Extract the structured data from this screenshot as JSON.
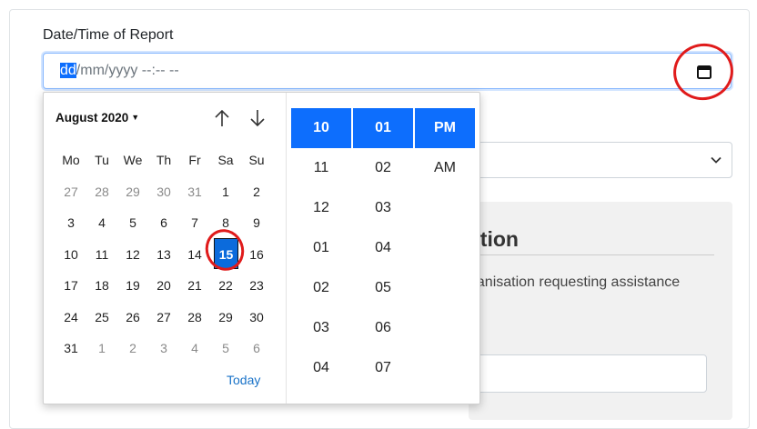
{
  "form": {
    "label": "Date/Time of Report",
    "input_selected": "dd",
    "input_rest": "/mm/yyyy --:-- --",
    "panel_heading": "ation",
    "panel_text": "ganisation requesting assistance"
  },
  "picker": {
    "month_label": "August 2020",
    "weekdays": [
      "Mo",
      "Tu",
      "We",
      "Th",
      "Fr",
      "Sa",
      "Su"
    ],
    "weeks": [
      [
        "27",
        "28",
        "29",
        "30",
        "31",
        "1",
        "2"
      ],
      [
        "3",
        "4",
        "5",
        "6",
        "7",
        "8",
        "9"
      ],
      [
        "10",
        "11",
        "12",
        "13",
        "14",
        "15",
        "16"
      ],
      [
        "17",
        "18",
        "19",
        "20",
        "21",
        "22",
        "23"
      ],
      [
        "24",
        "25",
        "26",
        "27",
        "28",
        "29",
        "30"
      ],
      [
        "31",
        "1",
        "2",
        "3",
        "4",
        "5",
        "6"
      ]
    ],
    "selected_day": "15",
    "today_label": "Today",
    "hours": [
      "10",
      "11",
      "12",
      "01",
      "02",
      "03",
      "04"
    ],
    "minutes": [
      "01",
      "02",
      "03",
      "04",
      "05",
      "06",
      "07"
    ],
    "meridiem": [
      "PM",
      "AM"
    ],
    "selected_hour": "10",
    "selected_minute": "01",
    "selected_meridiem": "PM"
  },
  "icons": {
    "calendar": "calendar-icon",
    "up": "arrow-up-icon",
    "down": "arrow-down-icon",
    "select_chevron": "chevron-down-icon"
  },
  "colors": {
    "accent": "#0d6efd",
    "annotation": "#e01b1b"
  }
}
